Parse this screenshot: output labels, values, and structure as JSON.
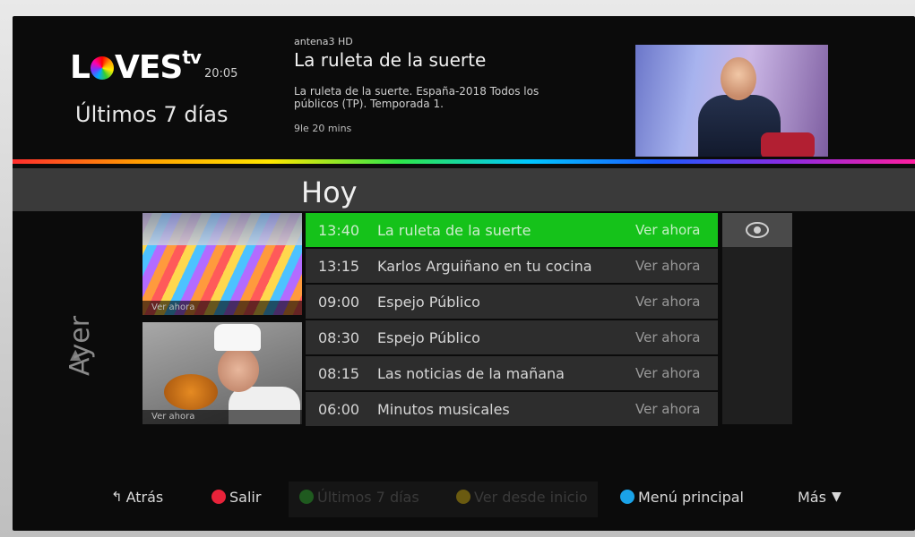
{
  "header": {
    "logo_text": "LOVEStv",
    "clock": "20:05",
    "section_title": "Últimos 7 días"
  },
  "now_playing": {
    "channel": "antena3 HD",
    "title": "La ruleta de la suerte",
    "description": "La ruleta de la suerte. España-2018 Todos los públicos (TP). Temporada 1.",
    "duration": "9le 20 mins"
  },
  "day_selected": "Hoy",
  "day_previous": "Ayer",
  "thumbnails": [
    {
      "caption": "Ver ahora"
    },
    {
      "caption": "Ver ahora"
    }
  ],
  "programs": [
    {
      "time": "13:40",
      "title": "La ruleta de la suerte",
      "action": "Ver ahora",
      "selected": true
    },
    {
      "time": "13:15",
      "title": "Karlos Arguiñano en tu cocina",
      "action": "Ver ahora",
      "selected": false
    },
    {
      "time": "09:00",
      "title": "Espejo Público",
      "action": "Ver ahora",
      "selected": false
    },
    {
      "time": "08:30",
      "title": "Espejo Público",
      "action": "Ver ahora",
      "selected": false
    },
    {
      "time": "08:15",
      "title": "Las noticias de la mañana",
      "action": "Ver ahora",
      "selected": false
    },
    {
      "time": "06:00",
      "title": "Minutos musicales",
      "action": "Ver ahora",
      "selected": false
    }
  ],
  "footer": {
    "back": "Atrás",
    "exit": "Salir",
    "last7": "Últimos 7 días",
    "from_start": "Ver desde inicio",
    "main_menu": "Menú principal",
    "more": "Más"
  },
  "colors": {
    "selected_row": "#15c21a",
    "red_button": "#e8233a",
    "green_button": "#1f7a1f",
    "yellow_button": "#7a6a10",
    "blue_button": "#1aa3e8"
  },
  "icons": {
    "back": "back-arrow-icon",
    "options": "eye-icon",
    "more": "chevron-down-icon"
  }
}
